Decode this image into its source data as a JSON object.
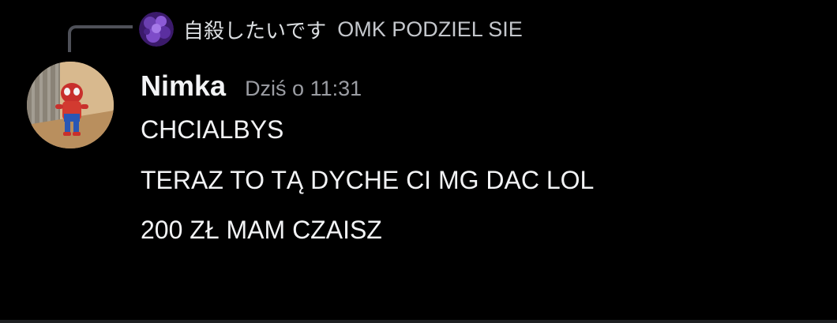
{
  "reply": {
    "avatar_icon": "purple-avatar-icon",
    "username": "自殺したいです",
    "text": "OMK PODZIEL SIE"
  },
  "message": {
    "avatar_icon": "spiderman-figure-avatar-icon",
    "username": "Nimka",
    "timestamp": "Dziś o 11:31",
    "lines": [
      "CHCIALBYS",
      "TERAZ TO TĄ DYCHE CI MG DAC LOL",
      "200 ZŁ MAM CZAISZ"
    ]
  },
  "colors": {
    "background": "#000000",
    "text_primary": "#f2f3f5",
    "text_muted": "#9b9da3",
    "spine": "#4e5058"
  }
}
